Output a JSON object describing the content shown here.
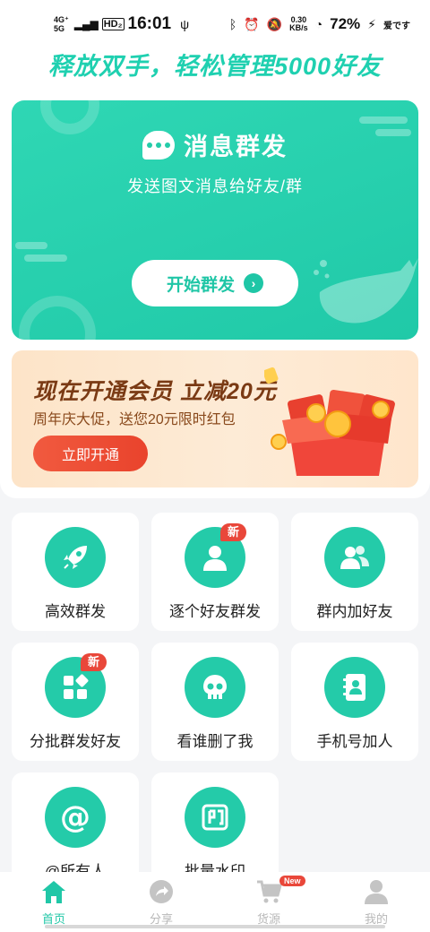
{
  "status_bar": {
    "net1": "4G⁺",
    "net2": "5G",
    "hd": "HD₂",
    "time": "16:01",
    "speed_value": "0.30",
    "speed_unit": "KB/s",
    "battery": "72%",
    "carrier": "爱です"
  },
  "slogan": "释放双手，轻松管理5000好友",
  "hero": {
    "title": "消息群发",
    "subtitle": "发送图文消息给好友/群",
    "button": "开始群发"
  },
  "promo": {
    "title": "现在开通会员  立减20元",
    "subtitle": "周年庆大促，送您20元限时红包",
    "button": "立即开通"
  },
  "grid": [
    {
      "label": "高效群发",
      "icon": "rocket-icon",
      "badge": ""
    },
    {
      "label": "逐个好友群发",
      "icon": "person-icon",
      "badge": "新"
    },
    {
      "label": "群内加好友",
      "icon": "group-icon",
      "badge": ""
    },
    {
      "label": "分批群发好友",
      "icon": "apps-icon",
      "badge": "新"
    },
    {
      "label": "看谁删了我",
      "icon": "skull-icon",
      "badge": ""
    },
    {
      "label": "手机号加人",
      "icon": "contact-book-icon",
      "badge": ""
    },
    {
      "label": "@所有人",
      "icon": "at-icon",
      "badge": ""
    },
    {
      "label": "批量水印",
      "icon": "stamp-icon",
      "badge": ""
    }
  ],
  "nav": [
    {
      "label": "首页",
      "icon": "home-icon",
      "active": true
    },
    {
      "label": "分享",
      "icon": "share-icon",
      "active": false
    },
    {
      "label": "货源",
      "icon": "cart-icon",
      "active": false,
      "tag": "New"
    },
    {
      "label": "我的",
      "icon": "user-icon",
      "active": false
    }
  ],
  "colors": {
    "accent": "#24cba9",
    "badge": "#e9473a",
    "promo_button": "#ec4a32"
  }
}
